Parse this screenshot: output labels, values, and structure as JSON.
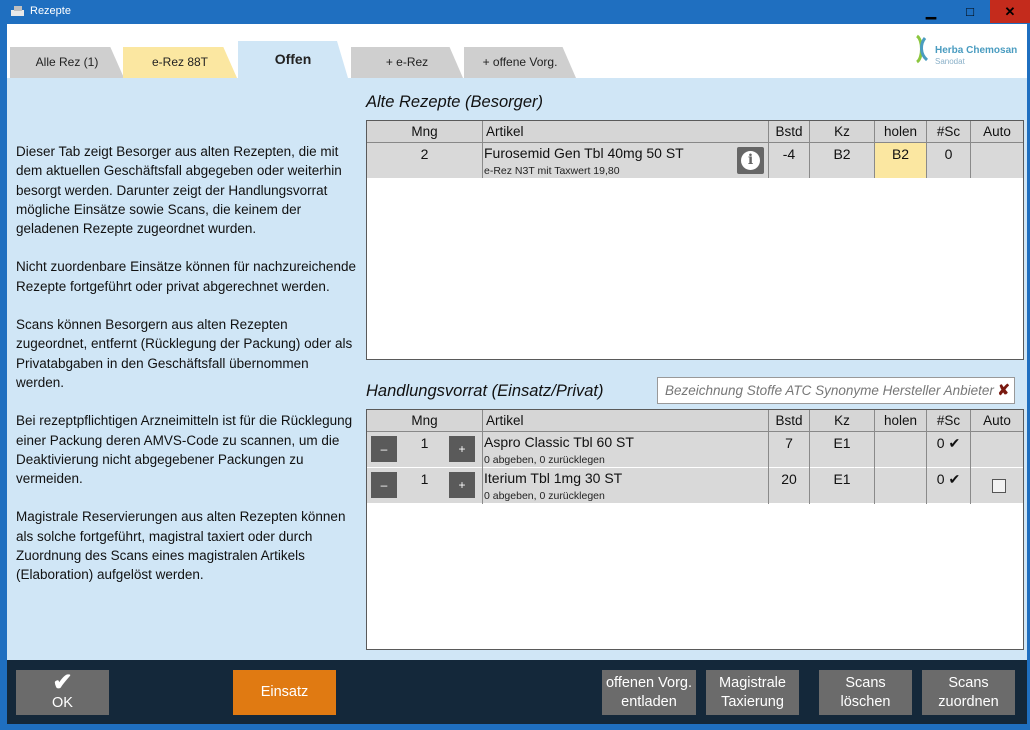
{
  "window": {
    "title": "Rezepte",
    "minimize": "▁",
    "maximize": "□",
    "close": "✕"
  },
  "tabs": [
    {
      "label": "Alle Rez (1)"
    },
    {
      "label": "e-Rez 88T"
    },
    {
      "label": "Offen"
    },
    {
      "label": "+ e-Rez"
    },
    {
      "label": "+ offene Vorg."
    }
  ],
  "logo": {
    "name": "Herba Chemosan",
    "sub": "Sanodat"
  },
  "description": [
    "Dieser Tab zeigt Besorger aus alten Rezepten, die mit dem aktuellen Geschäftsfall abgegeben oder weiterhin besorgt werden. Darunter zeigt der Handlungsvorrat mögliche Einsätze sowie Scans, die keinem der geladenen Rezepte zugeordnet wurden.",
    "Nicht zuordenbare Einsätze können für nachzureichende Rezepte fortgeführt oder privat abgerechnet werden.",
    "Scans können Besorgern aus alten Rezepten zugeordnet, entfernt (Rücklegung der Packung) oder als Privatabgaben in den Geschäftsfall übernommen werden.",
    "Bei rezeptpflichtigen Arzneimitteln ist für die Rücklegung einer Packung deren AMVS-Code zu scannen, um die Deaktivierung nicht abgegebener Packungen zu vermeiden.",
    "Magistrale Reservierungen aus alten Rezepten können als solche fortgeführt, magistral taxiert oder durch Zuordnung des Scans eines magistralen Artikels (Elaboration) aufgelöst werden."
  ],
  "columns": {
    "mng": "Mng",
    "artikel": "Artikel",
    "bstd": "Bstd",
    "kz": "Kz",
    "holen": "holen",
    "sc": "#Sc",
    "auto": "Auto"
  },
  "alte_rezepte": {
    "title": "Alte Rezepte (Besorger)",
    "rows": [
      {
        "mng": "2",
        "artikel": "Furosemid Gen Tbl 40mg 50 ST",
        "sub": "e-Rez N3T mit Taxwert 19,80",
        "bstd": "-4",
        "kz": "B2",
        "holen": "B2",
        "sc": "0",
        "auto": ""
      }
    ]
  },
  "handlungsvorrat": {
    "title": "Handlungsvorrat (Einsatz/Privat)",
    "search_placeholder": "Bezeichnung Stoffe ATC Synonyme Hersteller Anbieter",
    "search_clear": "✘",
    "minus": "–",
    "plus": "+",
    "rows": [
      {
        "mng": "1",
        "artikel": "Aspro Classic Tbl 60 ST",
        "sub": "0 abgeben, 0 zurücklegen",
        "bstd": "7",
        "kz": "E1",
        "holen": "",
        "sc": "0 ✔"
      },
      {
        "mng": "1",
        "artikel": "Iterium Tbl 1mg 30 ST",
        "sub": "0 abgeben, 0 zurücklegen",
        "bstd": "20",
        "kz": "E1",
        "holen": "",
        "sc": "0 ✔"
      }
    ]
  },
  "footer": {
    "ok": "OK",
    "ok_check": "✔",
    "einsatz": "Einsatz",
    "vorg_line1": "offenen Vorg.",
    "vorg_line2": "entladen",
    "mag_line1": "Magistrale",
    "mag_line2": "Taxierung",
    "sdel_line1": "Scans",
    "sdel_line2": "löschen",
    "sass_line1": "Scans",
    "sass_line2": "zuordnen"
  }
}
